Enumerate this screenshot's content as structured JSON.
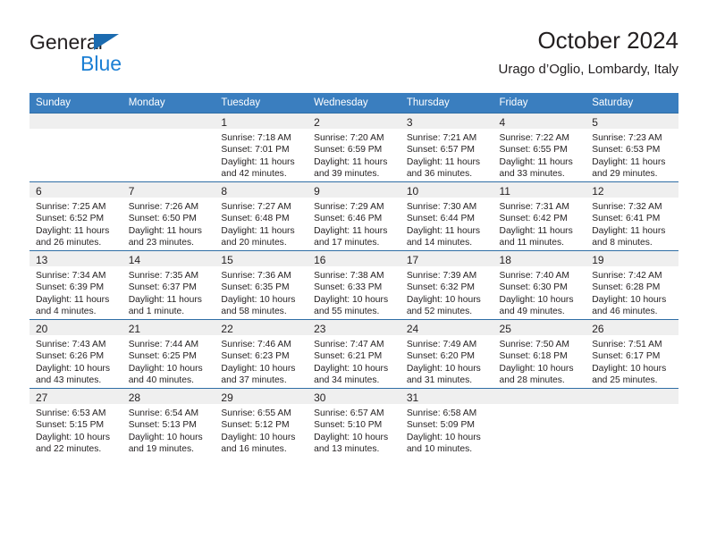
{
  "brand": {
    "name_part1": "General",
    "name_part2": "Blue",
    "triangle_icon": "triangle-icon",
    "accent_color": "#1b7fd4",
    "triangle_color": "#1b6bb0"
  },
  "header": {
    "title": "October 2024",
    "subtitle": "Urago d’Oglio, Lombardy, Italy"
  },
  "calendar": {
    "header_background": "#3a7ebf",
    "header_text_color": "#ffffff",
    "daynum_band_color": "#efefef",
    "row_border_color": "#2f6ea5",
    "weekday_headers": [
      "Sunday",
      "Monday",
      "Tuesday",
      "Wednesday",
      "Thursday",
      "Friday",
      "Saturday"
    ],
    "weeks": [
      [
        {
          "day": "",
          "empty": true,
          "sunrise": "",
          "sunset": "",
          "daylight_line1": "",
          "daylight_line2": ""
        },
        {
          "day": "",
          "empty": true,
          "sunrise": "",
          "sunset": "",
          "daylight_line1": "",
          "daylight_line2": ""
        },
        {
          "day": "1",
          "sunrise": "Sunrise: 7:18 AM",
          "sunset": "Sunset: 7:01 PM",
          "daylight_line1": "Daylight: 11 hours",
          "daylight_line2": "and 42 minutes."
        },
        {
          "day": "2",
          "sunrise": "Sunrise: 7:20 AM",
          "sunset": "Sunset: 6:59 PM",
          "daylight_line1": "Daylight: 11 hours",
          "daylight_line2": "and 39 minutes."
        },
        {
          "day": "3",
          "sunrise": "Sunrise: 7:21 AM",
          "sunset": "Sunset: 6:57 PM",
          "daylight_line1": "Daylight: 11 hours",
          "daylight_line2": "and 36 minutes."
        },
        {
          "day": "4",
          "sunrise": "Sunrise: 7:22 AM",
          "sunset": "Sunset: 6:55 PM",
          "daylight_line1": "Daylight: 11 hours",
          "daylight_line2": "and 33 minutes."
        },
        {
          "day": "5",
          "sunrise": "Sunrise: 7:23 AM",
          "sunset": "Sunset: 6:53 PM",
          "daylight_line1": "Daylight: 11 hours",
          "daylight_line2": "and 29 minutes."
        }
      ],
      [
        {
          "day": "6",
          "sunrise": "Sunrise: 7:25 AM",
          "sunset": "Sunset: 6:52 PM",
          "daylight_line1": "Daylight: 11 hours",
          "daylight_line2": "and 26 minutes."
        },
        {
          "day": "7",
          "sunrise": "Sunrise: 7:26 AM",
          "sunset": "Sunset: 6:50 PM",
          "daylight_line1": "Daylight: 11 hours",
          "daylight_line2": "and 23 minutes."
        },
        {
          "day": "8",
          "sunrise": "Sunrise: 7:27 AM",
          "sunset": "Sunset: 6:48 PM",
          "daylight_line1": "Daylight: 11 hours",
          "daylight_line2": "and 20 minutes."
        },
        {
          "day": "9",
          "sunrise": "Sunrise: 7:29 AM",
          "sunset": "Sunset: 6:46 PM",
          "daylight_line1": "Daylight: 11 hours",
          "daylight_line2": "and 17 minutes."
        },
        {
          "day": "10",
          "sunrise": "Sunrise: 7:30 AM",
          "sunset": "Sunset: 6:44 PM",
          "daylight_line1": "Daylight: 11 hours",
          "daylight_line2": "and 14 minutes."
        },
        {
          "day": "11",
          "sunrise": "Sunrise: 7:31 AM",
          "sunset": "Sunset: 6:42 PM",
          "daylight_line1": "Daylight: 11 hours",
          "daylight_line2": "and 11 minutes."
        },
        {
          "day": "12",
          "sunrise": "Sunrise: 7:32 AM",
          "sunset": "Sunset: 6:41 PM",
          "daylight_line1": "Daylight: 11 hours",
          "daylight_line2": "and 8 minutes."
        }
      ],
      [
        {
          "day": "13",
          "sunrise": "Sunrise: 7:34 AM",
          "sunset": "Sunset: 6:39 PM",
          "daylight_line1": "Daylight: 11 hours",
          "daylight_line2": "and 4 minutes."
        },
        {
          "day": "14",
          "sunrise": "Sunrise: 7:35 AM",
          "sunset": "Sunset: 6:37 PM",
          "daylight_line1": "Daylight: 11 hours",
          "daylight_line2": "and 1 minute."
        },
        {
          "day": "15",
          "sunrise": "Sunrise: 7:36 AM",
          "sunset": "Sunset: 6:35 PM",
          "daylight_line1": "Daylight: 10 hours",
          "daylight_line2": "and 58 minutes."
        },
        {
          "day": "16",
          "sunrise": "Sunrise: 7:38 AM",
          "sunset": "Sunset: 6:33 PM",
          "daylight_line1": "Daylight: 10 hours",
          "daylight_line2": "and 55 minutes."
        },
        {
          "day": "17",
          "sunrise": "Sunrise: 7:39 AM",
          "sunset": "Sunset: 6:32 PM",
          "daylight_line1": "Daylight: 10 hours",
          "daylight_line2": "and 52 minutes."
        },
        {
          "day": "18",
          "sunrise": "Sunrise: 7:40 AM",
          "sunset": "Sunset: 6:30 PM",
          "daylight_line1": "Daylight: 10 hours",
          "daylight_line2": "and 49 minutes."
        },
        {
          "day": "19",
          "sunrise": "Sunrise: 7:42 AM",
          "sunset": "Sunset: 6:28 PM",
          "daylight_line1": "Daylight: 10 hours",
          "daylight_line2": "and 46 minutes."
        }
      ],
      [
        {
          "day": "20",
          "sunrise": "Sunrise: 7:43 AM",
          "sunset": "Sunset: 6:26 PM",
          "daylight_line1": "Daylight: 10 hours",
          "daylight_line2": "and 43 minutes."
        },
        {
          "day": "21",
          "sunrise": "Sunrise: 7:44 AM",
          "sunset": "Sunset: 6:25 PM",
          "daylight_line1": "Daylight: 10 hours",
          "daylight_line2": "and 40 minutes."
        },
        {
          "day": "22",
          "sunrise": "Sunrise: 7:46 AM",
          "sunset": "Sunset: 6:23 PM",
          "daylight_line1": "Daylight: 10 hours",
          "daylight_line2": "and 37 minutes."
        },
        {
          "day": "23",
          "sunrise": "Sunrise: 7:47 AM",
          "sunset": "Sunset: 6:21 PM",
          "daylight_line1": "Daylight: 10 hours",
          "daylight_line2": "and 34 minutes."
        },
        {
          "day": "24",
          "sunrise": "Sunrise: 7:49 AM",
          "sunset": "Sunset: 6:20 PM",
          "daylight_line1": "Daylight: 10 hours",
          "daylight_line2": "and 31 minutes."
        },
        {
          "day": "25",
          "sunrise": "Sunrise: 7:50 AM",
          "sunset": "Sunset: 6:18 PM",
          "daylight_line1": "Daylight: 10 hours",
          "daylight_line2": "and 28 minutes."
        },
        {
          "day": "26",
          "sunrise": "Sunrise: 7:51 AM",
          "sunset": "Sunset: 6:17 PM",
          "daylight_line1": "Daylight: 10 hours",
          "daylight_line2": "and 25 minutes."
        }
      ],
      [
        {
          "day": "27",
          "sunrise": "Sunrise: 6:53 AM",
          "sunset": "Sunset: 5:15 PM",
          "daylight_line1": "Daylight: 10 hours",
          "daylight_line2": "and 22 minutes."
        },
        {
          "day": "28",
          "sunrise": "Sunrise: 6:54 AM",
          "sunset": "Sunset: 5:13 PM",
          "daylight_line1": "Daylight: 10 hours",
          "daylight_line2": "and 19 minutes."
        },
        {
          "day": "29",
          "sunrise": "Sunrise: 6:55 AM",
          "sunset": "Sunset: 5:12 PM",
          "daylight_line1": "Daylight: 10 hours",
          "daylight_line2": "and 16 minutes."
        },
        {
          "day": "30",
          "sunrise": "Sunrise: 6:57 AM",
          "sunset": "Sunset: 5:10 PM",
          "daylight_line1": "Daylight: 10 hours",
          "daylight_line2": "and 13 minutes."
        },
        {
          "day": "31",
          "sunrise": "Sunrise: 6:58 AM",
          "sunset": "Sunset: 5:09 PM",
          "daylight_line1": "Daylight: 10 hours",
          "daylight_line2": "and 10 minutes."
        },
        {
          "day": "",
          "empty": true,
          "sunrise": "",
          "sunset": "",
          "daylight_line1": "",
          "daylight_line2": ""
        },
        {
          "day": "",
          "empty": true,
          "sunrise": "",
          "sunset": "",
          "daylight_line1": "",
          "daylight_line2": ""
        }
      ]
    ]
  }
}
